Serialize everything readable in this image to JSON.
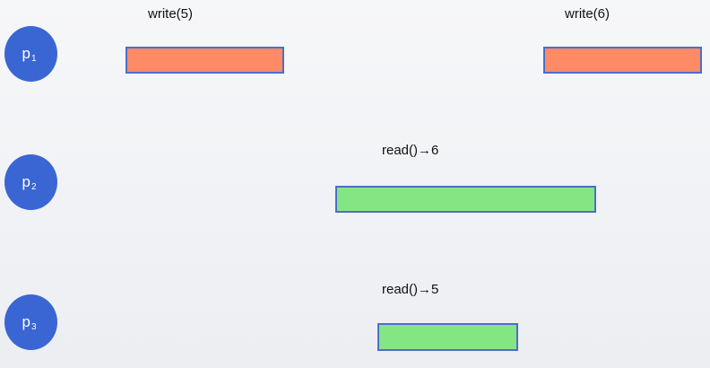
{
  "processes": [
    {
      "letter": "p",
      "index": "1"
    },
    {
      "letter": "p",
      "index": "2"
    },
    {
      "letter": "p",
      "index": "3"
    }
  ],
  "operations": {
    "p1_write_5": {
      "label": "write(5)",
      "color": "#ff8a66"
    },
    "p1_write_6": {
      "label": "write(6)",
      "color": "#ff8a66"
    },
    "p2_read": {
      "label": "read()→6",
      "color": "#84e683"
    },
    "p3_read": {
      "label": "read()→5",
      "color": "#84e683"
    }
  },
  "colors": {
    "process_node": "#3a66d4",
    "bar_border": "#4a6fc9"
  }
}
